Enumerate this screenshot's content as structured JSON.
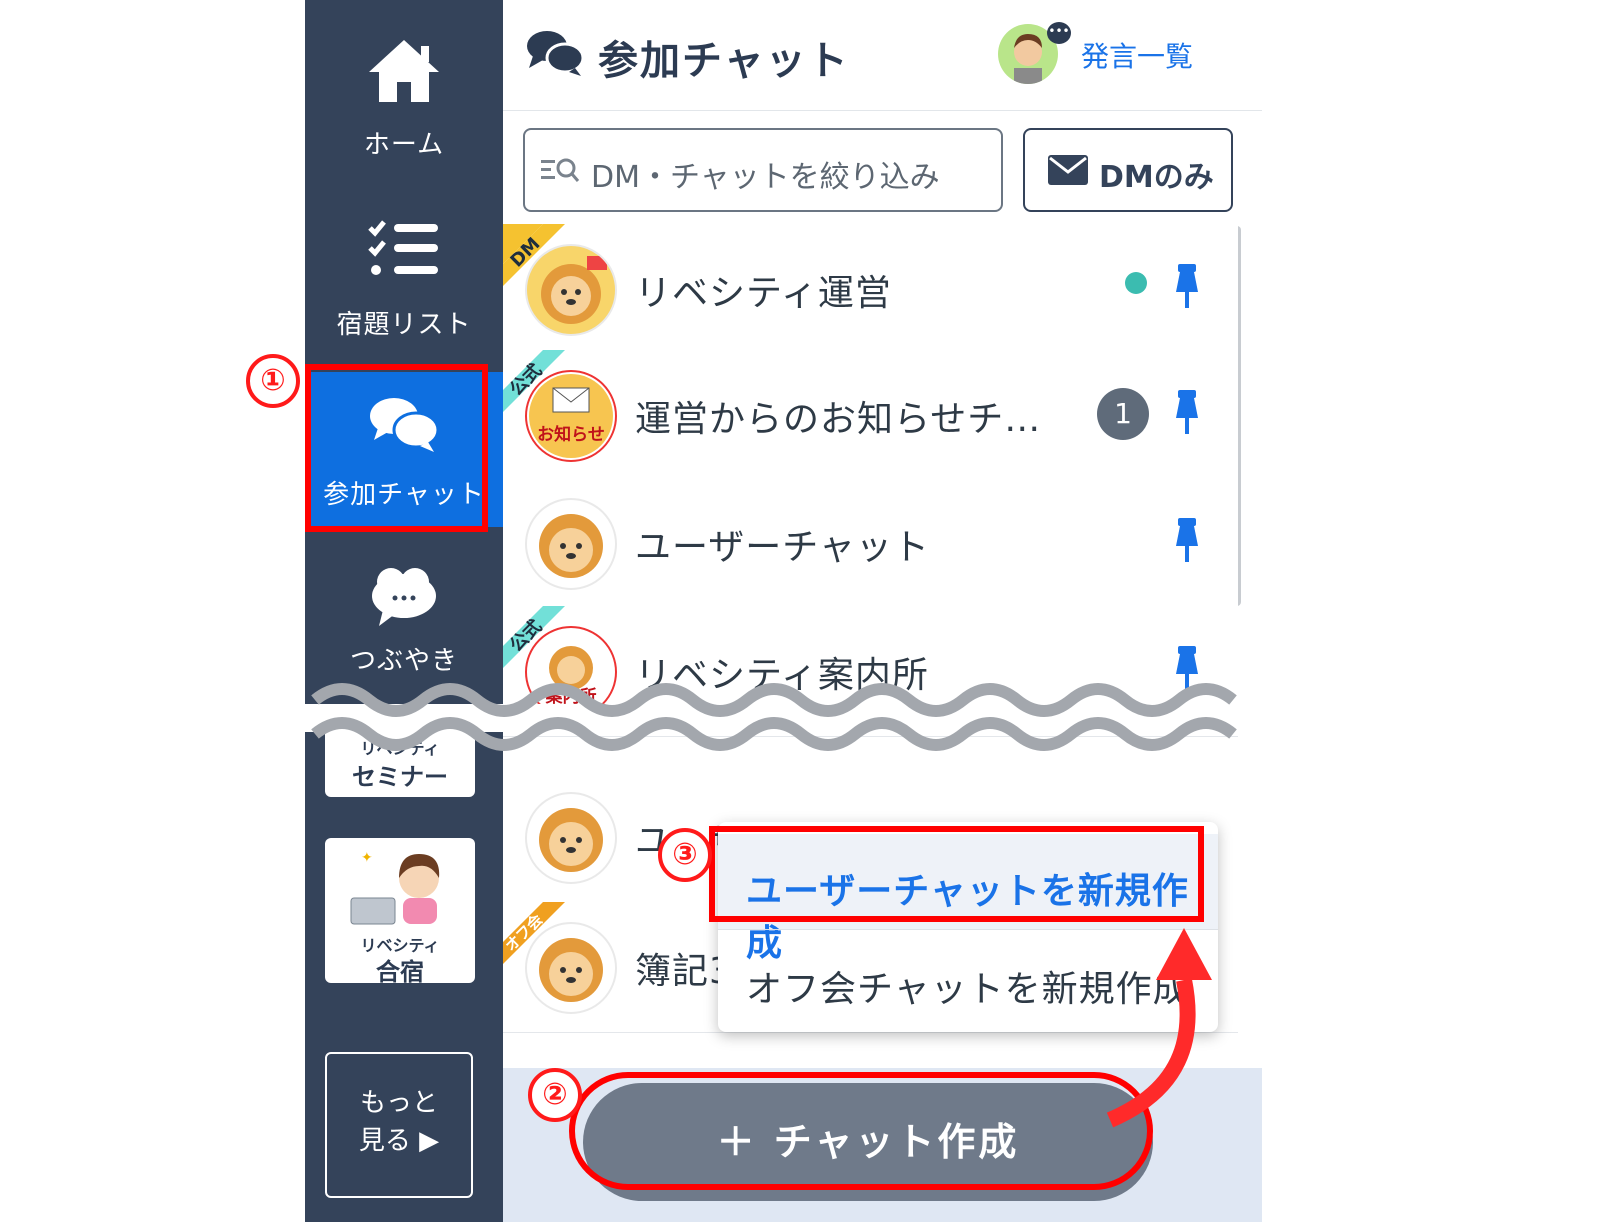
{
  "sidebar": {
    "home_label": "ホーム",
    "homework_label": "宿題リスト",
    "chat_label": "参加チャット",
    "tweet_label": "つぶやき",
    "seminar_banner_top": "リベシティ",
    "seminar_banner_bottom": "セミナー",
    "camp_banner_top": "リベシティ",
    "camp_banner_bottom": "合宿",
    "more_line1": "もっと",
    "more_line2": "見る ▶"
  },
  "header": {
    "title": "参加チャット",
    "link_label": "発言一覧"
  },
  "search": {
    "placeholder": "DM・チャットを絞り込み",
    "dm_only_label": "DMのみ"
  },
  "chats": [
    {
      "name": "リベシティ運営",
      "ribbon": "DM",
      "status": "online-dot"
    },
    {
      "name": "運営からのお知らせチ…",
      "ribbon": "公式",
      "unread": "1",
      "avatar_text": "お知らせ"
    },
    {
      "name": "ユーザーチャット"
    },
    {
      "name": "リベシティ案内所",
      "ribbon": "公式",
      "avatar_text": "案内所"
    },
    {
      "name": "ユーザ"
    },
    {
      "name": "簿記3",
      "ribbon": "オフ会"
    }
  ],
  "dropdown": {
    "item1": "ユーザーチャットを新規作成",
    "item2": "オフ会チャットを新規作成"
  },
  "bottom": {
    "create_label": "＋ チャット作成"
  },
  "annotations": {
    "step1": "①",
    "step2": "②",
    "step3": "③"
  },
  "colors": {
    "sidebar": "#34435a",
    "active": "#0e6fe0",
    "accent_blue": "#1a73e8",
    "annotation_red": "#ff0000",
    "ribbon_dm": "#f5c230",
    "ribbon_official": "#72e0d8",
    "ribbon_offkai": "#f0a020"
  }
}
